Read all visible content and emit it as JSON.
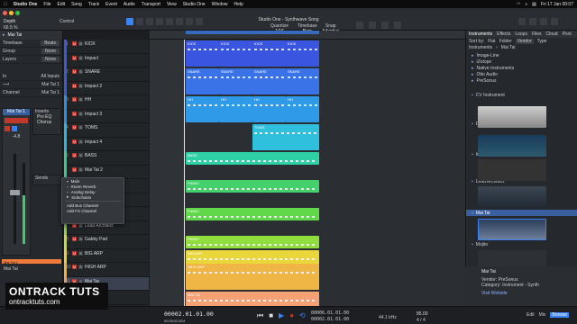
{
  "macbar": {
    "app": "Studio One",
    "menus": [
      "File",
      "Edit",
      "Song",
      "Track",
      "Event",
      "Audio",
      "Transport",
      "View",
      "Studio One",
      "Window",
      "Help"
    ],
    "clock": "Fri 17 Jan 00:07"
  },
  "window": {
    "title": "Studio One - Synthwave Song"
  },
  "toolbar": {
    "quantize_label": "Quantize",
    "quantize_value": "1/16",
    "timebase_label": "Timebase",
    "timebase_value": "Bars",
    "snap_label": "Snap",
    "snap_value": "Adaptive"
  },
  "inspector": {
    "track_name": "Depth",
    "control_label": "Control",
    "channel_value": "66.5 %",
    "instrument": "Mai Tai",
    "timebase": "Timebase",
    "timebase_value": "Beats",
    "group": "Group",
    "group_value": "None",
    "layers": "Layers",
    "layers_value": "None",
    "in": "In",
    "in_value": "All Inputs",
    "out_value": "Mai Tai 1",
    "channel": "Channel",
    "channel_value2": "Mai Tai 1",
    "inserts": [
      "Inserts",
      "Pro EQ",
      "Chorus"
    ],
    "sends": "Sends",
    "fader_value": "-4.8",
    "bottom_name": "Mai Tai",
    "bottom_sub": "Mai Tai 1"
  },
  "tracks": [
    {
      "num": "1",
      "name": "KICK",
      "color": "#3b5bd6"
    },
    {
      "num": "",
      "name": "Impact",
      "color": "#3b5bd6"
    },
    {
      "num": "2",
      "name": "SNARE",
      "color": "#3b5bd6"
    },
    {
      "num": "",
      "name": "Impact 2",
      "color": "#3b5bd6"
    },
    {
      "num": "3",
      "name": "HH",
      "color": "#2e8ee0"
    },
    {
      "num": "",
      "name": "Impact 3",
      "color": "#2e8ee0"
    },
    {
      "num": "4",
      "name": "TOMS",
      "color": "#2fb5d8"
    },
    {
      "num": "",
      "name": "Impact 4",
      "color": "#2fb5d8"
    },
    {
      "num": "5",
      "name": "BASS",
      "color": "#3ec98c"
    },
    {
      "num": "",
      "name": "Mai Tai 2",
      "color": "#3ec98c"
    },
    {
      "num": "6",
      "name": "PIANO",
      "color": "#49c957"
    },
    {
      "num": "",
      "name": "Presence",
      "color": "#49c957"
    },
    {
      "num": "7",
      "name": "PAD SYNTH",
      "color": "#8bd640"
    },
    {
      "num": "",
      "name": "Lead Architect",
      "color": "#8bd640"
    },
    {
      "num": "8",
      "name": "Gabby Pad",
      "color": "#c6dd34"
    },
    {
      "num": "9",
      "name": "BIG ARP",
      "color": "#e8d030"
    },
    {
      "num": "10",
      "name": "HIGH ARP",
      "color": "#eeb13a"
    },
    {
      "num": "11",
      "name": "Mai Tai",
      "color": "#f29a5c"
    },
    {
      "num": "",
      "name": "Mai Tai 5",
      "color": "#f29a5c"
    }
  ],
  "clips": [
    {
      "label": "KICK",
      "color": "#3a56e0"
    },
    {
      "label": "KICK",
      "color": "#3a56e0"
    },
    {
      "label": "KICK",
      "color": "#3a56e0"
    },
    {
      "label": "KICK",
      "color": "#3a56e0"
    },
    {
      "label": "SNARE",
      "color": "#3a73e8"
    },
    {
      "label": "SNARE",
      "color": "#3a73e8"
    },
    {
      "label": "SNARE",
      "color": "#3a73e8"
    },
    {
      "label": "SNARE",
      "color": "#3a73e8"
    },
    {
      "label": "HH",
      "color": "#2f9ae8"
    },
    {
      "label": "HH",
      "color": "#2f9ae8"
    },
    {
      "label": "HH",
      "color": "#2f9ae8"
    },
    {
      "label": "HH",
      "color": "#2f9ae8"
    },
    {
      "label": "TOMS",
      "color": "#2ec0dc"
    },
    {
      "label": "BASS",
      "color": "#2fd0a6"
    },
    {
      "label": "PIANO",
      "color": "#44d16c"
    },
    {
      "label": "PIANO",
      "color": "#60d84a"
    },
    {
      "label": "PIANO",
      "color": "#8fde3d"
    },
    {
      "label": "BIG ARP",
      "color": "#e9d63a"
    },
    {
      "label": "HIGH ARP",
      "color": "#f0b645"
    },
    {
      "label": "MAI TAI",
      "color": "#f5a173"
    }
  ],
  "menu": {
    "items": [
      "Main",
      "Room Reverb",
      "Analog Delay",
      "Sidechains",
      "Add Bus Channel",
      "Add FX Channel"
    ]
  },
  "browser": {
    "tabs": [
      "Instruments",
      "Effects",
      "Loops",
      "Files",
      "Cloud",
      "Pool"
    ],
    "sort_label": "Sort by:",
    "sort_options": [
      "Flat",
      "Folder",
      "Vendor",
      "Type"
    ],
    "crumbs": [
      "Instruments",
      "Mai Tai"
    ],
    "rows": [
      "Image-Line",
      "iZotope",
      "Native Instruments",
      "Otto Audio",
      "PreSonus",
      "CV Instrument",
      "Deep Flight One",
      "Impact",
      "Lead Architect",
      "Mai Tai",
      "Mojito"
    ],
    "info_name": "Mai Tai",
    "info_vendor": "Vendor: PreSonus",
    "info_category": "Category: Instrument - Synth",
    "visit": "Visit Website"
  },
  "transport": {
    "time_main": "00002.01.01.00",
    "time_sub": "00:00:02.824",
    "loop_start": "00006.01.01.00",
    "loop_end": "00002.01.01.00",
    "tempo": "85.00",
    "time_sig": "4 / 4",
    "sample_rate": "44.1 kHz",
    "edit": "Edit",
    "mix": "Mix",
    "browse": "Browse"
  },
  "logo": {
    "text": "ONTRACK TUTS",
    "url": "ontracktuts.com"
  },
  "colors": {
    "accent": "#3b82f6",
    "mute": "#c23a30",
    "selected": "#3a5f9e"
  }
}
